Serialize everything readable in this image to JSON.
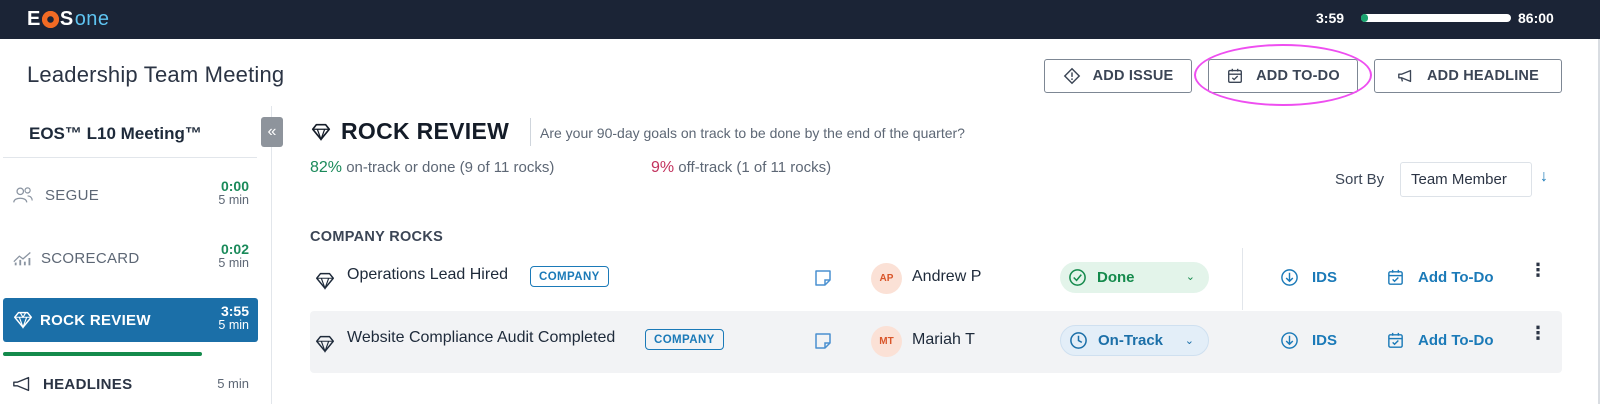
{
  "brand": {
    "logo_e": "E",
    "logo_s": "S",
    "logo_one": "one"
  },
  "timer": {
    "elapsed": "3:59",
    "total": "86:00",
    "progress": 0.046
  },
  "meeting": {
    "title": "Leadership Team Meeting"
  },
  "header_buttons": {
    "add_issue": "ADD ISSUE",
    "add_todo": "ADD TO-DO",
    "add_headline": "ADD HEADLINE"
  },
  "agenda": {
    "title": "EOS™ L10 Meeting™",
    "collapse_glyph": "«",
    "items": [
      {
        "label": "SEGUE",
        "time": "0:00",
        "duration": "5 min",
        "icon": "people-icon"
      },
      {
        "label": "SCORECARD",
        "time": "0:02",
        "duration": "5 min",
        "icon": "chart-icon"
      },
      {
        "label": "ROCK REVIEW",
        "time": "3:55",
        "duration": "5 min",
        "icon": "diamond-icon"
      },
      {
        "label": "HEADLINES",
        "time": "",
        "duration": "5 min",
        "icon": "megaphone-icon"
      }
    ]
  },
  "section": {
    "title": "ROCK REVIEW",
    "subtitle": "Are your 90-day goals on track to be done by the end of the quarter?",
    "on_track_pct": "82%",
    "on_track_text": " on-track or done (9 of 11 rocks)",
    "off_track_pct": "9%",
    "off_track_text": " off-track (1 of 11 rocks)",
    "sort_label": "Sort By",
    "sort_value": "Team Member",
    "sort_arrow": "↓"
  },
  "group": {
    "title": "COMPANY ROCKS"
  },
  "rocks": [
    {
      "title": "Operations Lead Hired",
      "badge": "COMPANY",
      "owner_initials": "AP",
      "owner": "Andrew P",
      "status": "Done",
      "ids": "IDS",
      "add_todo": "Add To-Do",
      "more": "⋮"
    },
    {
      "title": "Website Compliance Audit Completed",
      "badge": "COMPANY",
      "owner_initials": "MT",
      "owner": "Mariah T",
      "status": "On-Track",
      "ids": "IDS",
      "add_todo": "Add To-Do",
      "more": "⋮"
    }
  ],
  "colors": {
    "topbar": "#1b2436",
    "active_item": "#1b6fa8",
    "on_track": "#1a8a5a",
    "off_track": "#c2315d",
    "link": "#1b7ab8",
    "highlight": "#ee4ef0"
  }
}
